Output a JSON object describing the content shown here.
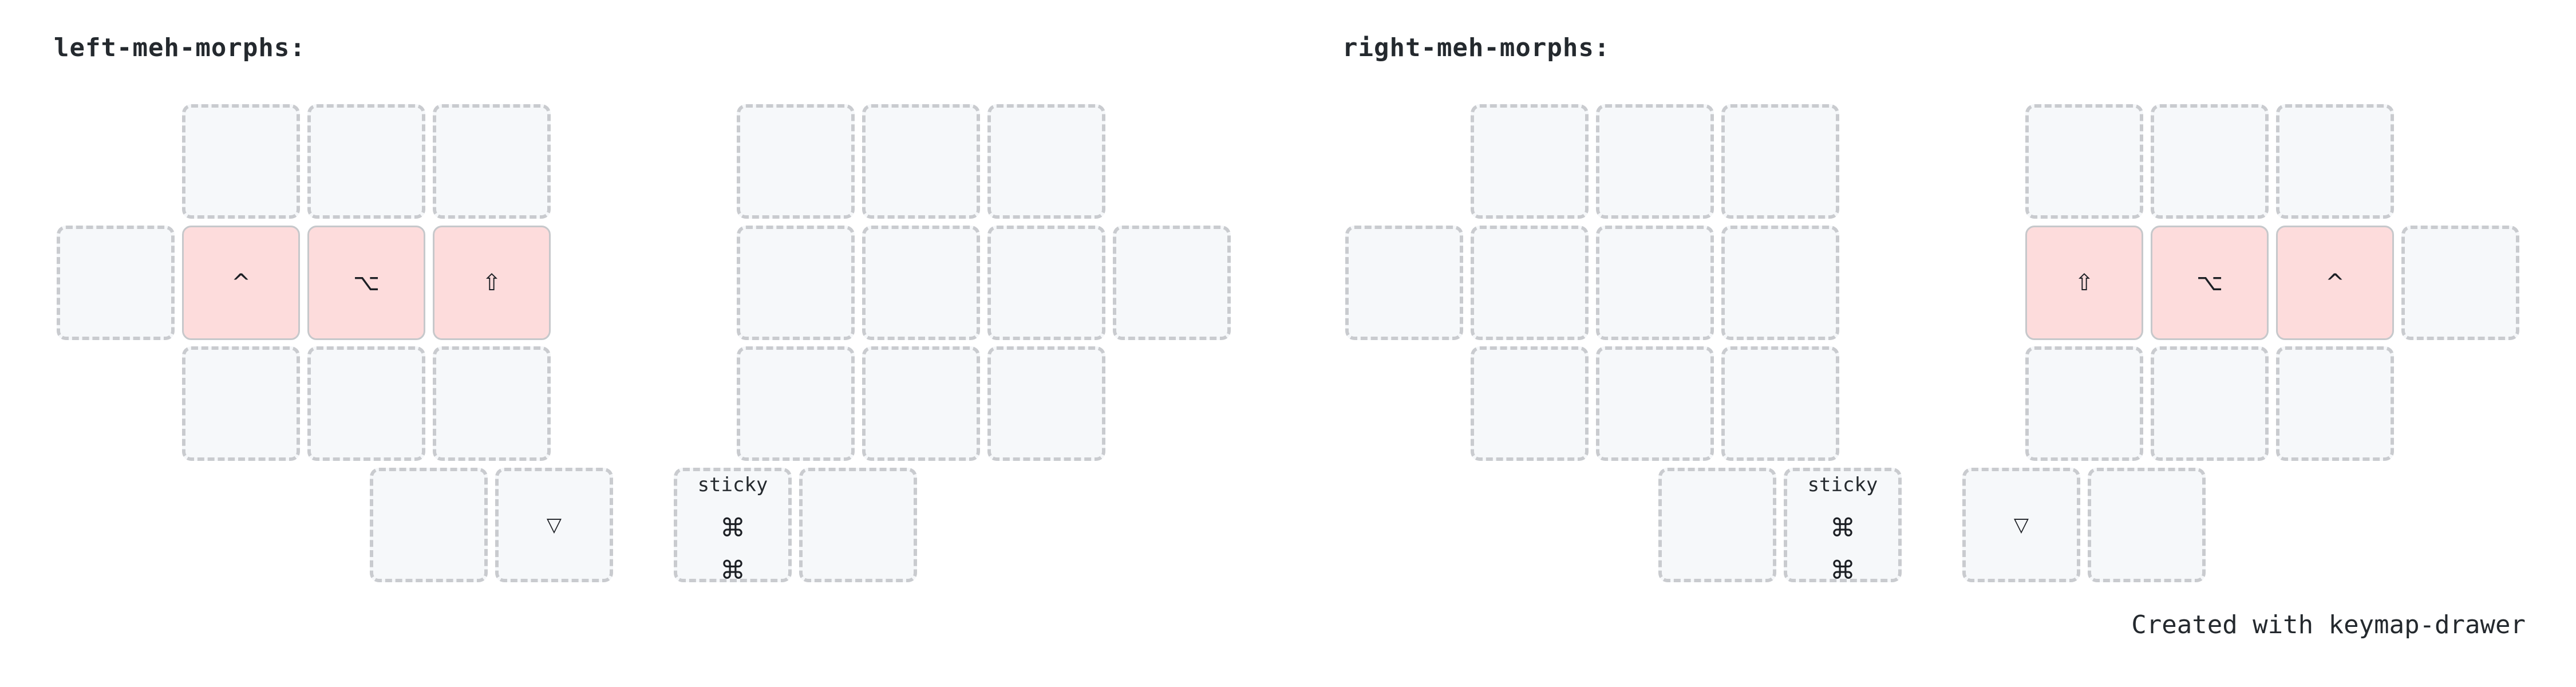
{
  "layers": [
    {
      "title": "left-meh-morphs:",
      "keys": {
        "ctrl": "^",
        "alt": "⌥",
        "shift": "⇧",
        "trans_thumb": "▽",
        "sticky_label": "sticky",
        "cmd_top": "⌘",
        "cmd_bottom": "⌘"
      }
    },
    {
      "title": "right-meh-morphs:",
      "keys": {
        "shift": "⇧",
        "alt": "⌥",
        "ctrl": "^",
        "trans_thumb": "▽",
        "sticky_label": "sticky",
        "cmd_top": "⌘",
        "cmd_bottom": "⌘"
      }
    }
  ],
  "footer": "Created with keymap-drawer",
  "colors": {
    "held_key_fill": "#fddcdc",
    "key_fill": "#f6f8fa",
    "key_border": "#c9cbcf"
  }
}
